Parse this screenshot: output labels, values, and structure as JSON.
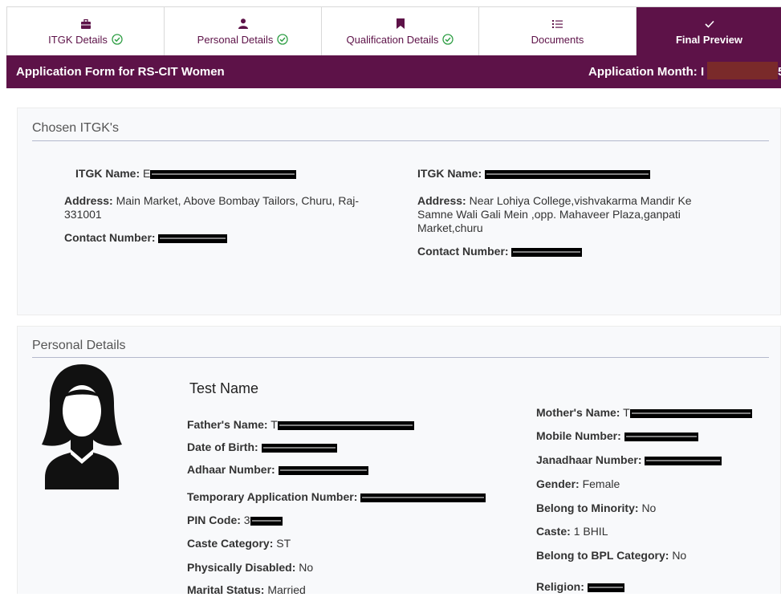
{
  "tabs": [
    {
      "label": "ITGK Details",
      "icon": "briefcase-icon",
      "completed": true,
      "active": false
    },
    {
      "label": "Personal Details",
      "icon": "user-icon",
      "completed": true,
      "active": false
    },
    {
      "label": "Qualification Details",
      "icon": "bookmark-icon",
      "completed": true,
      "active": false
    },
    {
      "label": "Documents",
      "icon": "list-icon",
      "completed": false,
      "active": false
    },
    {
      "label": "Final Preview",
      "icon": "checkmark-icon",
      "completed": false,
      "active": true
    }
  ],
  "header": {
    "title": "Application Form for RS-CIT Women",
    "month_label": "Application Month: I",
    "month_tail": "5"
  },
  "itgk": {
    "section_title": "Chosen ITGK's",
    "left": {
      "name_label": "ITGK Name:",
      "name_prefix": "E",
      "address_label": "Address:",
      "address_line1": "Main Market, Above Bombay Tailors, Churu, Raj-",
      "address_line2": "331001",
      "contact_label": "Contact Number:"
    },
    "right": {
      "name_label": "ITGK Name:",
      "address_label": "Address:",
      "address_line1": "Near Lohiya College,vishvakarma Mandir Ke",
      "address_line2": "Samne Wali Gali Mein ,opp. Mahaveer Plaza,ganpati",
      "address_line3": "Market,churu",
      "contact_label": "Contact Number:"
    }
  },
  "personal": {
    "section_title": "Personal Details",
    "name": "Test Name",
    "father_label": "Father's Name:",
    "father_prefix": "T",
    "dob_label": "Date of Birth:",
    "adhaar_label": "Adhaar Number:",
    "temp_app_label": "Temporary Application Number:",
    "pin_label": "PIN Code:",
    "pin_prefix": "3",
    "caste_cat_label": "Caste Category:",
    "caste_cat_value": "ST",
    "disabled_label": "Physically Disabled:",
    "disabled_value": "No",
    "marital_label": "Marital Status:",
    "marital_value": "Married",
    "mother_label": "Mother's Name:",
    "mother_prefix": "T",
    "mobile_label": "Mobile Number:",
    "janadhaar_label": "Janadhaar Number:",
    "gender_label": "Gender:",
    "gender_value": "Female",
    "minority_label": "Belong to Minority:",
    "minority_value": "No",
    "caste_label": "Caste:",
    "caste_value": "1 BHIL",
    "bpl_label": "Belong to BPL Category:",
    "bpl_value": "No",
    "religion_label": "Religion:"
  },
  "colors": {
    "brand": "#5d1248",
    "check": "#2e9e44",
    "redaction": "#000000"
  }
}
